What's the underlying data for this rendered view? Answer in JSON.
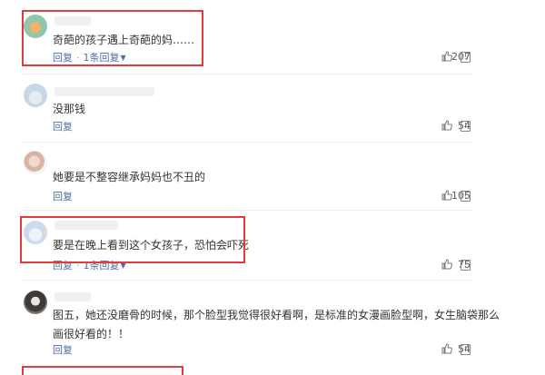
{
  "comments": [
    {
      "text": "奇葩的孩子遇上奇葩的妈……",
      "reply_label": "回复",
      "sep": "·",
      "thread_label": "1条回复",
      "likes": "207"
    },
    {
      "text": "没那钱",
      "reply_label": "回复",
      "likes": "54"
    },
    {
      "text": "她要是不整容继承妈妈也不丑的",
      "reply_label": "回复",
      "likes": "105"
    },
    {
      "text": "要是在晚上看到这个女孩子，恐怕会吓死",
      "reply_label": "回复",
      "sep": "·",
      "thread_label": "1条回复",
      "likes": "75"
    },
    {
      "text": "图五，她还没磨骨的时候，那个脸型我觉得很好看啊，是标准的女漫画脸型啊，女生脑袋那么画很好看的！！",
      "reply_label": "回复",
      "likes": "54"
    }
  ],
  "icons": {
    "thumb": "thumbs-up-icon",
    "report": "report-icon",
    "chevron": "chevron-down-icon"
  },
  "colors": {
    "highlight": "#e5393b",
    "link": "#4a6fa5"
  }
}
